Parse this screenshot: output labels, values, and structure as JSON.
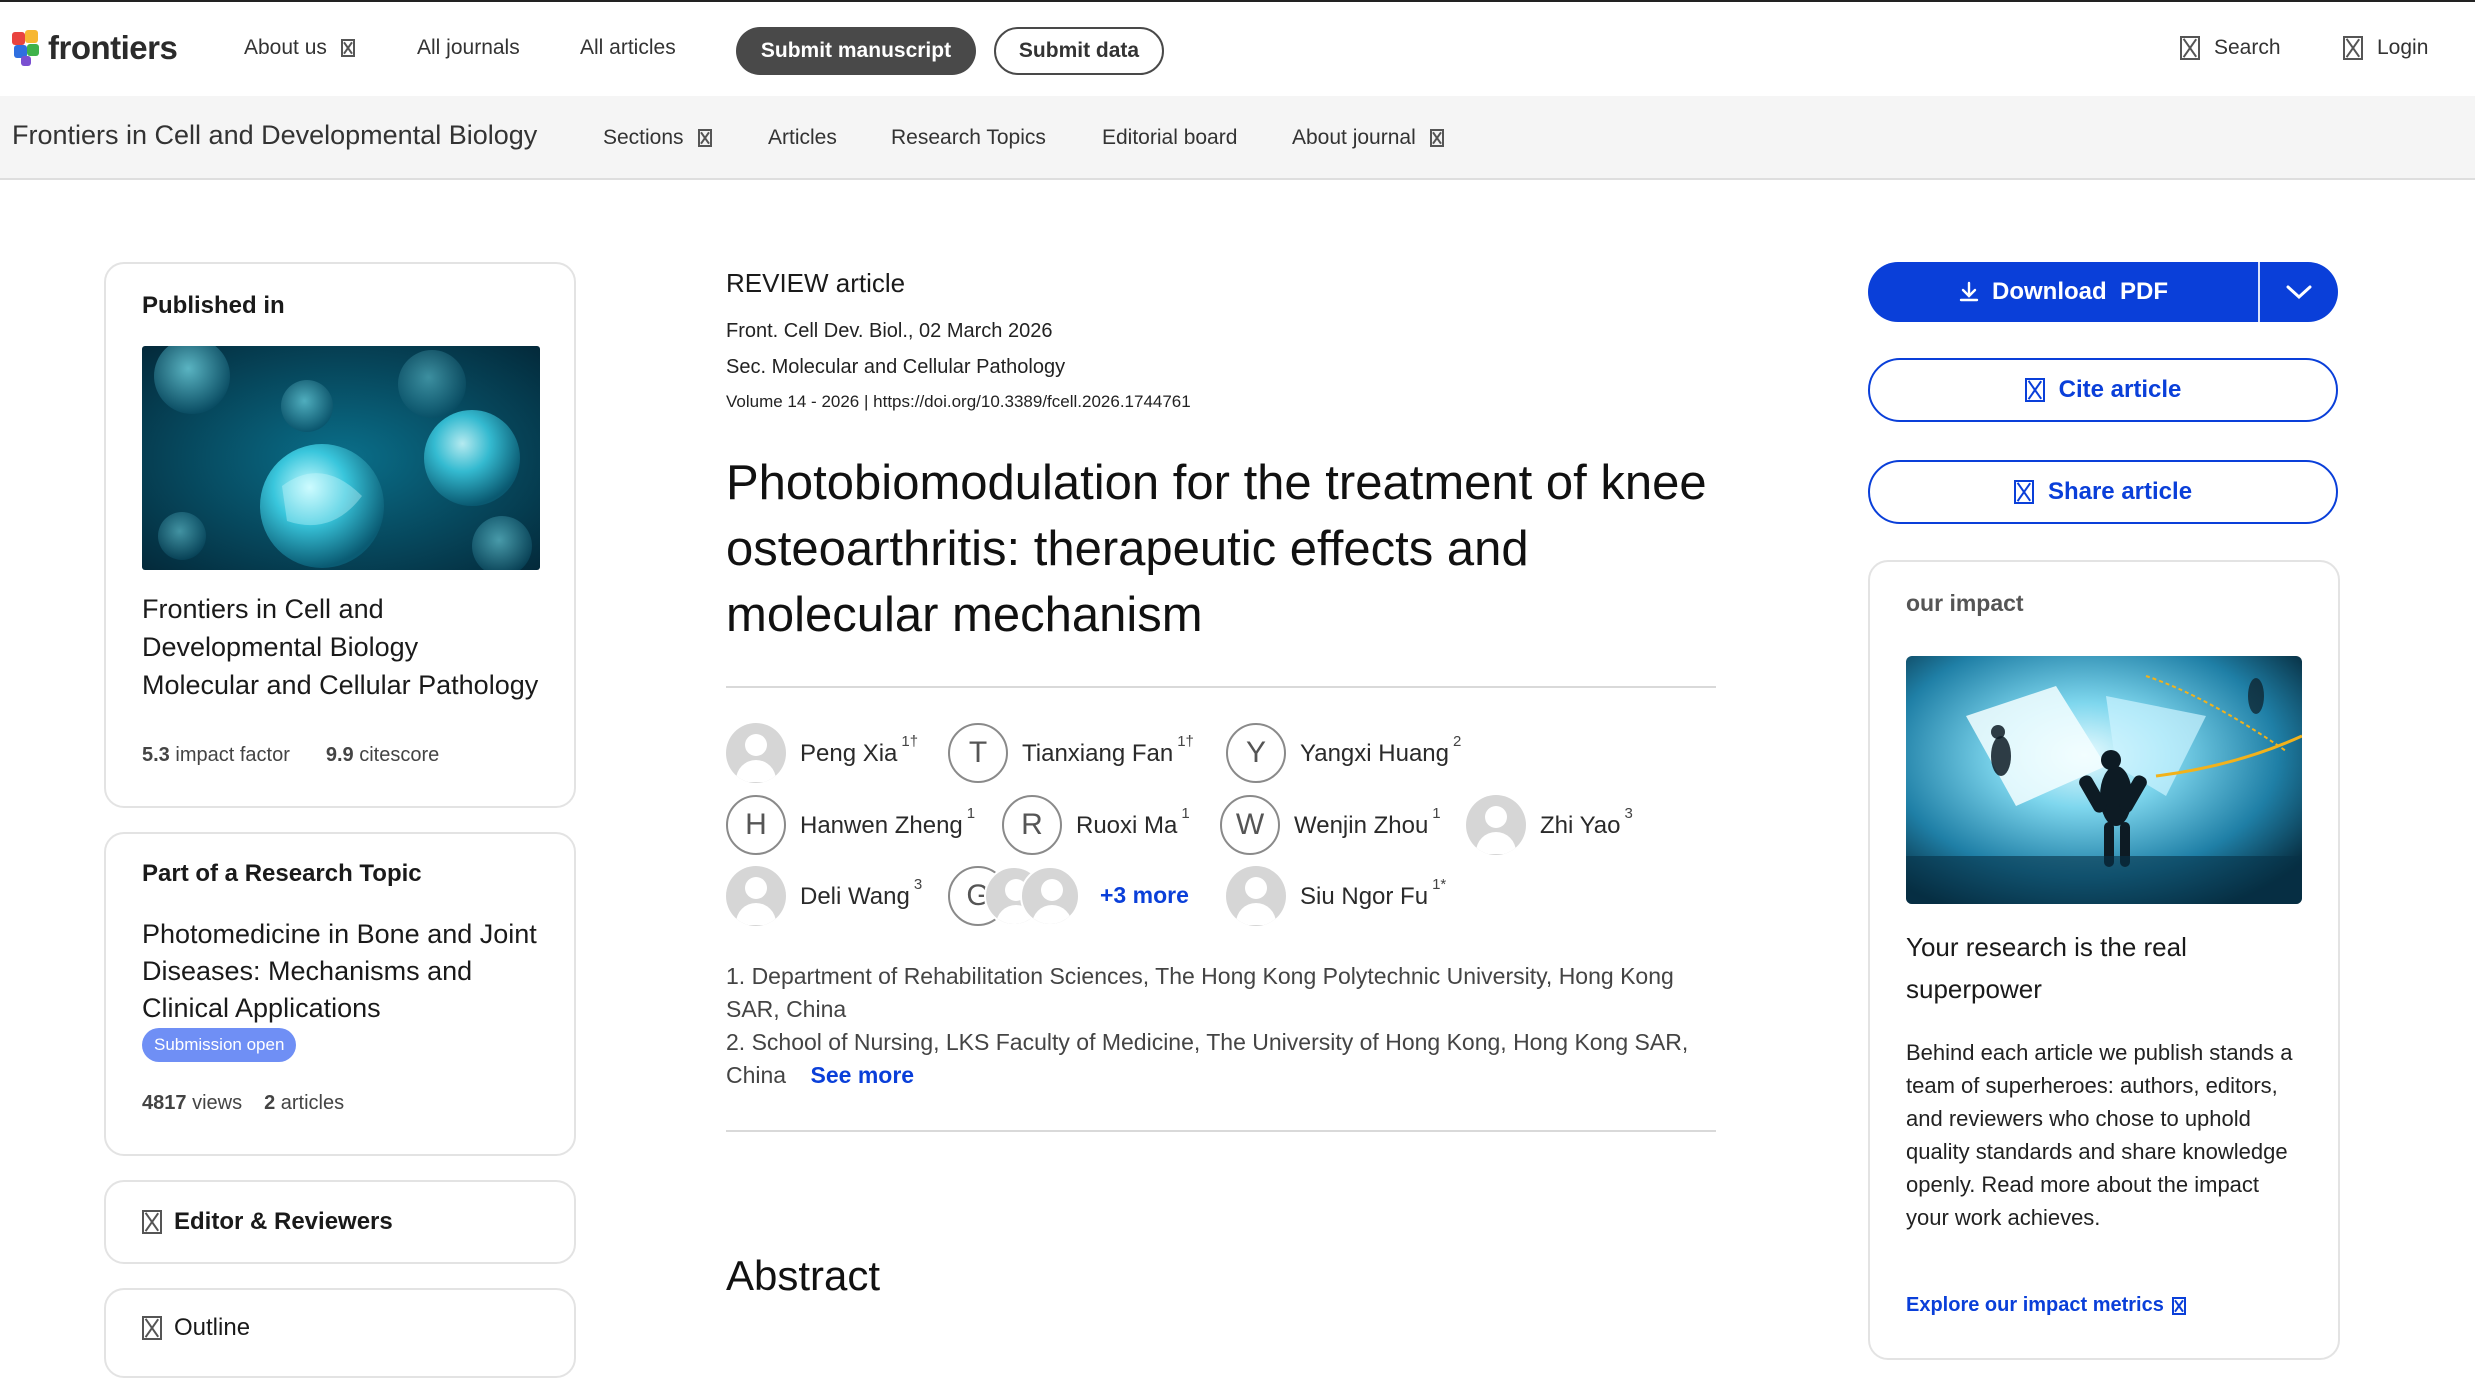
{
  "brand": {
    "name": "frontiers",
    "colors": {
      "accent_blue": "#0a3fd9",
      "dark_pill": "#494949",
      "badge": "#6f8ff5"
    }
  },
  "topnav": {
    "about": "About us",
    "journals": "All journals",
    "articles": "All articles",
    "submit_manuscript": "Submit manuscript",
    "submit_data": "Submit data",
    "search": "Search",
    "login": "Login"
  },
  "journal_nav": {
    "title": "Frontiers in Cell and Developmental Biology",
    "sections": "Sections",
    "articles": "Articles",
    "research_topics": "Research Topics",
    "editorial_board": "Editorial board",
    "about_journal": "About journal"
  },
  "published_in": {
    "heading": "Published in",
    "journal_line1": "Frontiers in Cell and",
    "journal_line2": "Developmental Biology",
    "section": "Molecular and Cellular Pathology",
    "impact_value": "5.3",
    "impact_label": "impact factor",
    "citescore_value": "9.9",
    "citescore_label": "citescore"
  },
  "research_topic": {
    "heading": "Part of a Research Topic",
    "title": "Photomedicine in Bone and Joint Diseases: Mechanisms and Clinical Applications",
    "badge": "Submission open",
    "views_value": "4817",
    "views_label": "views",
    "articles_value": "2",
    "articles_label": "articles"
  },
  "sidebar_cards": {
    "editors": "Editor & Reviewers",
    "outline": "Outline"
  },
  "article": {
    "type": "REVIEW article",
    "journal_date": "Front. Cell Dev. Biol., 02 March 2026",
    "section": "Sec. Molecular and Cellular Pathology",
    "volume": "Volume 14 - 2026 |",
    "doi": "https://doi.org/10.3389/fcell.2026.1744761",
    "title": "Photobiomodulation for the treatment of knee osteoarthritis: therapeutic effects and molecular mechanism",
    "authors": [
      {
        "name": "Peng Xia",
        "sup": "1†",
        "avatar": "photo"
      },
      {
        "name": "Tianxiang Fan",
        "sup": "1†",
        "avatar": "T"
      },
      {
        "name": "Yangxi Huang",
        "sup": "2",
        "avatar": "Y"
      },
      {
        "name": "Hanwen Zheng",
        "sup": "1",
        "avatar": "H"
      },
      {
        "name": "Ruoxi Ma",
        "sup": "1",
        "avatar": "R"
      },
      {
        "name": "Wenjin Zhou",
        "sup": "1",
        "avatar": "W"
      },
      {
        "name": "Zhi Yao",
        "sup": "3",
        "avatar": "photo"
      },
      {
        "name": "Deli Wang",
        "sup": "3",
        "avatar": "photo"
      },
      {
        "name": "Siu Ngor Fu",
        "sup": "1*",
        "avatar": "photo"
      }
    ],
    "group_initial": "G",
    "more_authors": "+3 more",
    "affiliations": [
      "1. Department of Rehabilitation Sciences, The Hong Kong Polytechnic University, Hong Kong SAR, China",
      "2. School of Nursing, LKS Faculty of Medicine, The University of Hong Kong, Hong Kong SAR, China"
    ],
    "see_more": "See more",
    "abstract_heading": "Abstract"
  },
  "actions": {
    "download": "Download  PDF",
    "cite": "Cite article",
    "share": "Share article"
  },
  "impact": {
    "heading": "our impact",
    "tagline": "Your research is the real superpower",
    "body": "Behind each article we publish stands a team of superheroes: authors, editors, and reviewers who chose to uphold quality standards and share knowledge openly. Read more about the impact your work achieves.",
    "link": "Explore our impact metrics"
  }
}
